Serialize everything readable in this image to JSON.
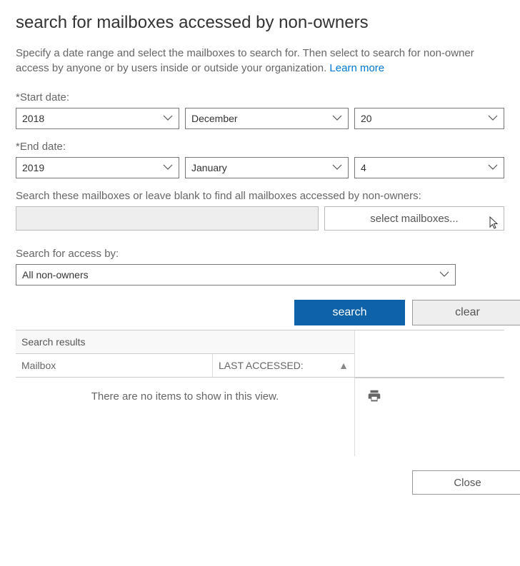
{
  "title": "search for mailboxes accessed by non-owners",
  "intro": {
    "text": "Specify a date range and select the mailboxes to search for. Then select to search for non-owner access by anyone or by users inside or outside your organization. ",
    "link": "Learn more"
  },
  "start": {
    "label": "*Start date:",
    "year": "2018",
    "month": "December",
    "day": "20"
  },
  "end": {
    "label": "*End date:",
    "year": "2019",
    "month": "January",
    "day": "4"
  },
  "mailboxes": {
    "label": "Search these mailboxes or leave blank to find all mailboxes accessed by non-owners:",
    "button": "select mailboxes..."
  },
  "accessBy": {
    "label": "Search for access by:",
    "value": "All non-owners"
  },
  "buttons": {
    "search": "search",
    "clear": "clear",
    "close": "Close"
  },
  "results": {
    "header": "Search results",
    "col_mailbox": "Mailbox",
    "col_last": "LAST ACCESSED:",
    "empty": "There are no items to show in this view."
  }
}
